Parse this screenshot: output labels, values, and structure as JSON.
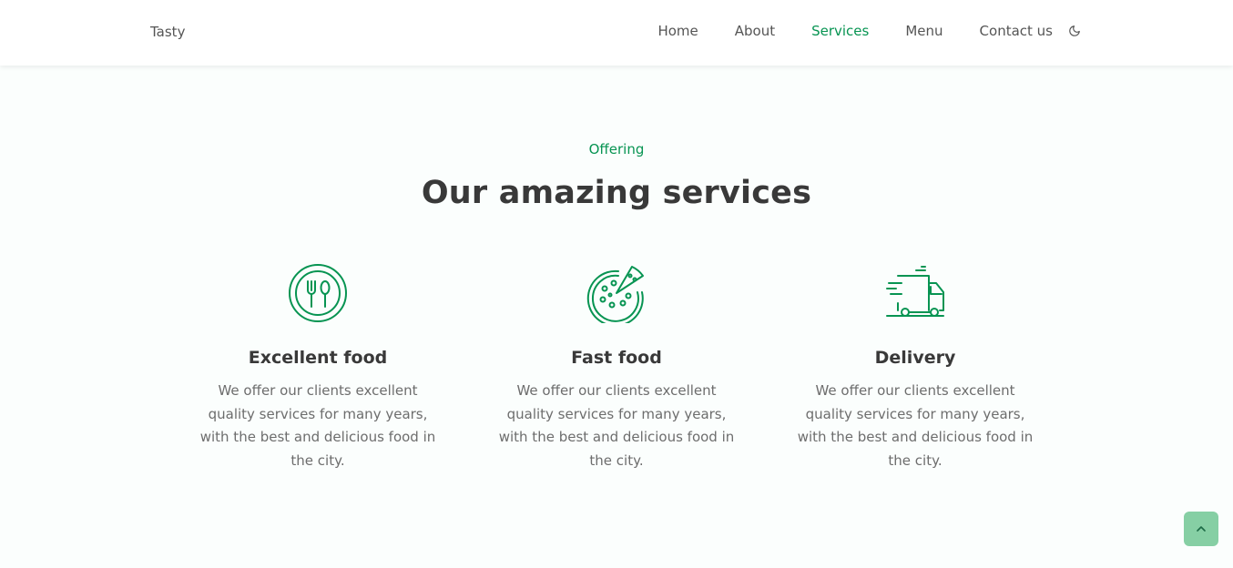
{
  "header": {
    "logo": "Tasty",
    "nav": [
      {
        "label": "Home"
      },
      {
        "label": "About"
      },
      {
        "label": "Services"
      },
      {
        "label": "Menu"
      },
      {
        "label": "Contact us"
      }
    ],
    "active_nav": "Services",
    "theme_icon": "moon-icon"
  },
  "section": {
    "subtitle": "Offering",
    "title": "Our amazing services"
  },
  "services": [
    {
      "icon": "cutlery-plate-icon",
      "title": "Excellent food",
      "description": "We offer our clients excellent quality services for many years, with the best and delicious food in the city."
    },
    {
      "icon": "pizza-icon",
      "title": "Fast food",
      "description": "We offer our clients excellent quality services for many years, with the best and delicious food in the city."
    },
    {
      "icon": "delivery-truck-icon",
      "title": "Delivery",
      "description": "We offer our clients excellent quality services for many years, with the best and delicious food in the city."
    }
  ],
  "scroll_up": {
    "icon": "chevron-up-icon"
  },
  "colors": {
    "accent": "#079452",
    "accent_light": "#86cfa4",
    "text_dark": "#393939",
    "text_muted": "#6d6d6d",
    "background": "#fbfefd"
  }
}
